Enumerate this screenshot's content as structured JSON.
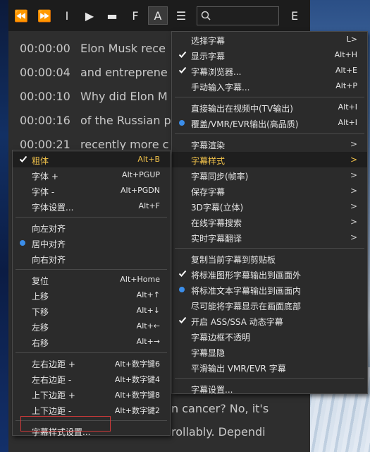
{
  "toolbar": {
    "buttons": [
      {
        "name": "rewind-icon",
        "glyph": "⏪"
      },
      {
        "name": "fast-forward-icon",
        "glyph": "⏩"
      },
      {
        "name": "text-cursor-icon",
        "glyph": "I"
      },
      {
        "name": "video-icon",
        "glyph": "▶"
      },
      {
        "name": "subtitle-box-icon",
        "glyph": "▬"
      },
      {
        "name": "font-f-icon",
        "glyph": "F"
      },
      {
        "name": "font-a-icon",
        "glyph": "A"
      },
      {
        "name": "menu-icon",
        "glyph": "☰"
      },
      {
        "name": "english-e-icon",
        "glyph": "E"
      }
    ],
    "search_placeholder": ""
  },
  "subtitles": [
    {
      "time": "00:00:00",
      "text": "Elon Musk rece"
    },
    {
      "time": "00:00:04",
      "text": "and entreprene"
    },
    {
      "time": "00:00:10",
      "text": "Why did Elon M"
    },
    {
      "time": "00:00:16",
      "text": "of the Russian p"
    },
    {
      "time": "00:00:21",
      "text": "recently more c"
    },
    {
      "time": "",
      "text": "n cancer? No, it's"
    },
    {
      "time": "",
      "text": "rollably. Dependi"
    }
  ],
  "main_menu": [
    {
      "label": "选择字幕",
      "shortcut": "L>"
    },
    {
      "label": "显示字幕",
      "shortcut": "Alt+H",
      "mark": "check"
    },
    {
      "label": "字幕浏览器...",
      "shortcut": "Alt+E",
      "mark": "check"
    },
    {
      "label": "手动输入字幕...",
      "shortcut": "Alt+P"
    },
    {
      "sep": true
    },
    {
      "label": "直接输出在视频中(TV输出)",
      "shortcut": "Alt+I"
    },
    {
      "label": "覆盖/VMR/EVR输出(高品质)",
      "shortcut": "Alt+I",
      "mark": "dot"
    },
    {
      "sep": true
    },
    {
      "label": "字幕渲染",
      "arrow": ">"
    },
    {
      "label": "字幕样式",
      "arrow": ">",
      "highlight": true
    },
    {
      "label": "字幕同步(帧率)",
      "arrow": ">"
    },
    {
      "label": "保存字幕",
      "arrow": ">"
    },
    {
      "label": "3D字幕(立体)",
      "arrow": ">"
    },
    {
      "label": "在线字幕搜索",
      "arrow": ">"
    },
    {
      "label": "实时字幕翻译",
      "arrow": ">"
    },
    {
      "sep": true
    },
    {
      "label": "复制当前字幕到剪贴板"
    },
    {
      "label": "将标准图形字幕输出到画面外",
      "mark": "check"
    },
    {
      "label": "将标准文本字幕输出到画面内",
      "mark": "dot"
    },
    {
      "label": "尽可能将字幕显示在画面底部"
    },
    {
      "label": "开启 ASS/SSA 动态字幕",
      "mark": "check"
    },
    {
      "label": "字幕边框不透明"
    },
    {
      "label": "字幕显隐"
    },
    {
      "label": "平滑输出 VMR/EVR 字幕"
    },
    {
      "sep": true
    },
    {
      "label": "字幕设置..."
    }
  ],
  "style_menu": [
    {
      "label": "粗体",
      "shortcut": "Alt+B",
      "mark": "check",
      "highlight": true
    },
    {
      "label": "字体 +",
      "shortcut": "Alt+PGUP"
    },
    {
      "label": "字体 -",
      "shortcut": "Alt+PGDN"
    },
    {
      "label": "字体设置...",
      "shortcut": "Alt+F"
    },
    {
      "sep": true
    },
    {
      "label": "向左对齐"
    },
    {
      "label": "居中对齐",
      "mark": "dot"
    },
    {
      "label": "向右对齐"
    },
    {
      "sep": true
    },
    {
      "label": "复位",
      "shortcut": "Alt+Home"
    },
    {
      "label": "上移",
      "shortcut": "Alt+↑"
    },
    {
      "label": "下移",
      "shortcut": "Alt+↓"
    },
    {
      "label": "左移",
      "shortcut": "Alt+←"
    },
    {
      "label": "右移",
      "shortcut": "Alt+→"
    },
    {
      "sep": true
    },
    {
      "label": "左右边距 +",
      "shortcut": "Alt+数字键6"
    },
    {
      "label": "左右边距 -",
      "shortcut": "Alt+数字键4"
    },
    {
      "label": "上下边距 +",
      "shortcut": "Alt+数字键8"
    },
    {
      "label": "上下边距 -",
      "shortcut": "Alt+数字键2"
    },
    {
      "sep": true
    },
    {
      "label": "字幕样式设置..."
    }
  ],
  "colors": {
    "accent_highlight": "#f0c14a",
    "radio_dot": "#3b8eea",
    "annotation_box": "#d23a3a"
  }
}
